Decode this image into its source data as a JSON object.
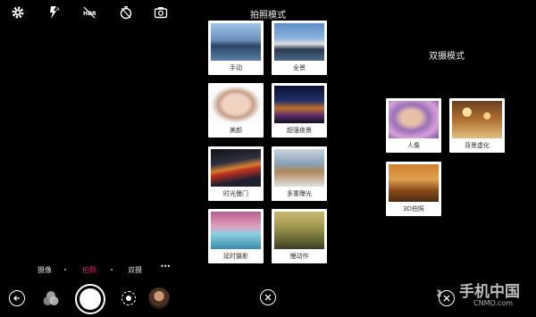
{
  "top_icons": [
    "gear-icon",
    "flash-auto-icon",
    "hdr-off-icon",
    "timer-off-icon",
    "switch-camera-icon"
  ],
  "photo_modes": {
    "title": "拍照模式",
    "items": [
      {
        "label": "手动",
        "thumb": "city-skyline"
      },
      {
        "label": "全景",
        "thumb": "panorama"
      },
      {
        "label": "美颜",
        "thumb": "portrait-makeup"
      },
      {
        "label": "超强夜景",
        "thumb": "night-city"
      },
      {
        "label": "时光慢门",
        "thumb": "light-trails"
      },
      {
        "label": "多重曝光",
        "thumb": "double-exposure"
      },
      {
        "label": "延时摄影",
        "thumb": "timelapse"
      },
      {
        "label": "慢动作",
        "thumb": "slow-motion"
      }
    ]
  },
  "dual_modes": {
    "title": "双摄模式",
    "items": [
      {
        "label": "人像",
        "thumb": "portrait-flowers"
      },
      {
        "label": "背景虚化",
        "thumb": "bokeh"
      },
      {
        "label": "3D拍照",
        "thumb": "3d-deer"
      }
    ]
  },
  "mode_bar": {
    "items": [
      "摄像",
      "拍照",
      "双摄"
    ],
    "selected": "拍照",
    "more": "•••"
  },
  "colors": {
    "accent": "#e0246a",
    "card_bg": "#ffffff",
    "background": "#000000"
  },
  "watermark": {
    "brand": "手机中国",
    "sub": "CNMO.com"
  }
}
